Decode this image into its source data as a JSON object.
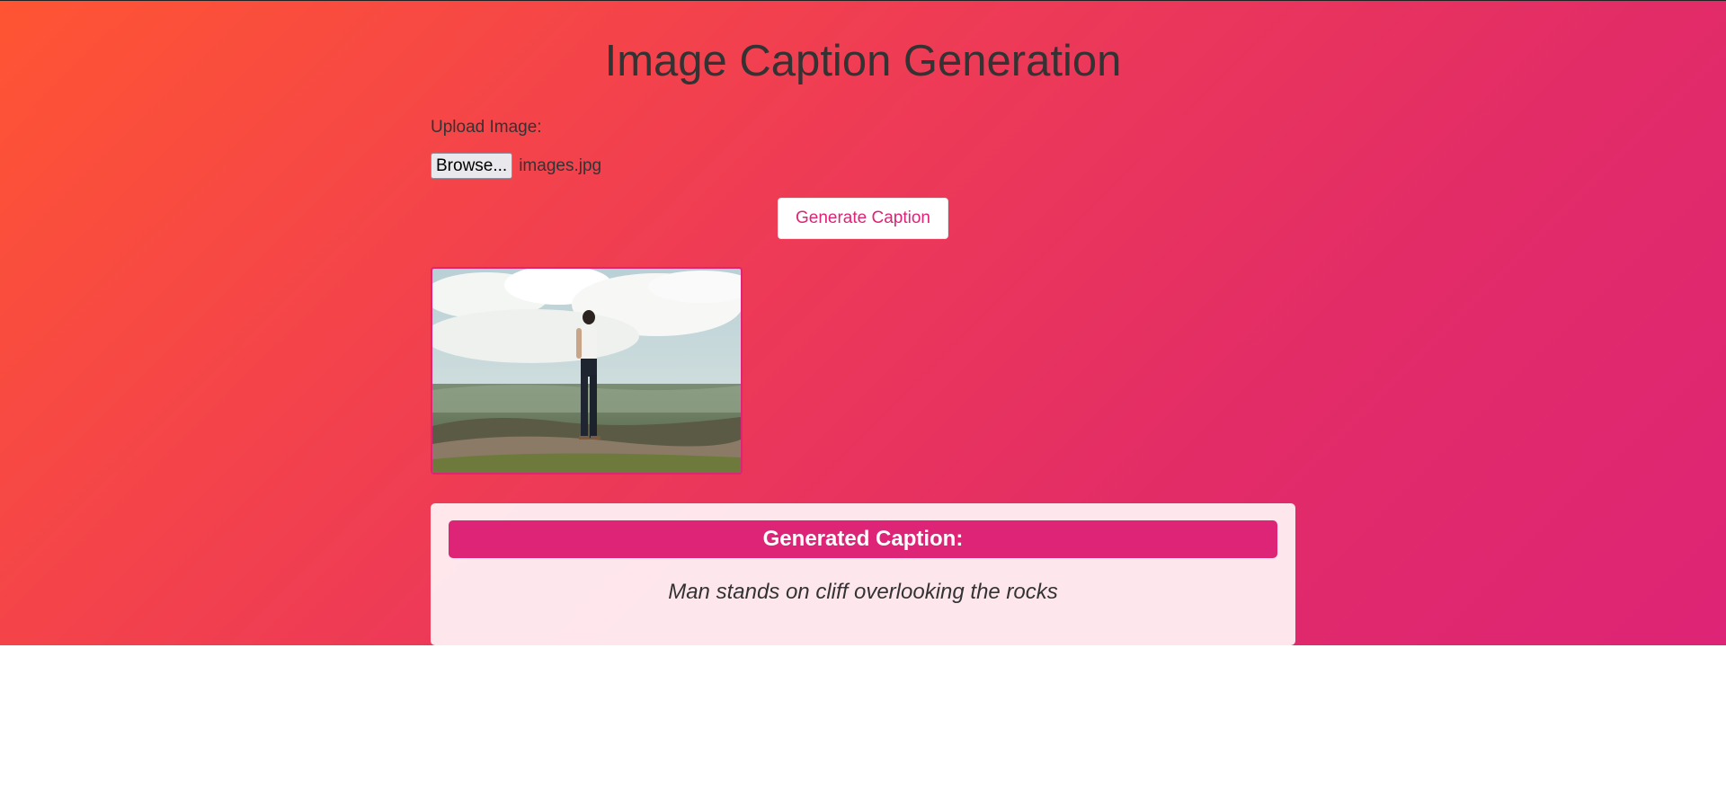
{
  "page": {
    "title": "Image Caption Generation"
  },
  "upload": {
    "label": "Upload Image:",
    "browse_label": "Browse...",
    "file_name": "images.jpg"
  },
  "actions": {
    "generate_label": "Generate Caption"
  },
  "result": {
    "header": "Generated Caption:",
    "caption": "Man stands on cliff overlooking the rocks"
  },
  "colors": {
    "accent": "#dd2476",
    "gradient_start": "#ff5533",
    "gradient_end": "#dd2476"
  },
  "icons": {
    "preview": "uploaded-image-preview"
  }
}
